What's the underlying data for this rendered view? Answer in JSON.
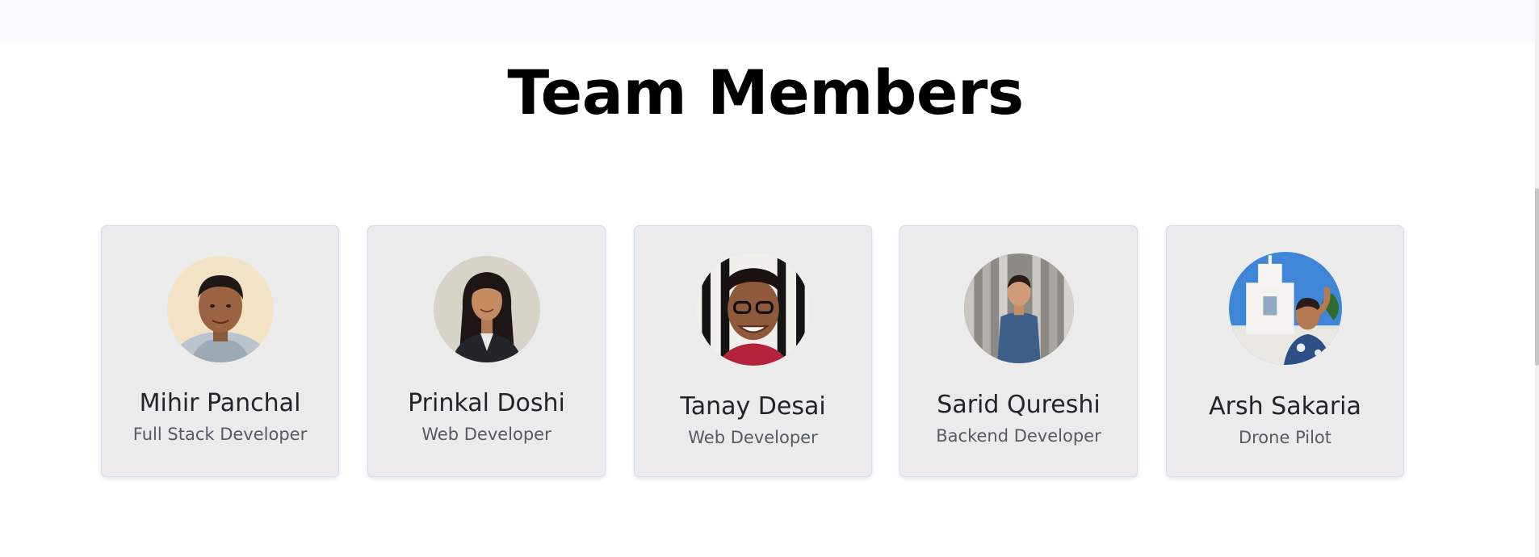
{
  "section": {
    "title": "Team Members"
  },
  "members": [
    {
      "name": "Mihir Panchal",
      "role": "Full Stack Developer"
    },
    {
      "name": "Prinkal Doshi",
      "role": "Web Developer"
    },
    {
      "name": "Tanay Desai",
      "role": "Web Developer"
    },
    {
      "name": "Sarid Qureshi",
      "role": "Backend Developer"
    },
    {
      "name": "Arsh Sakaria",
      "role": "Drone Pilot"
    }
  ]
}
